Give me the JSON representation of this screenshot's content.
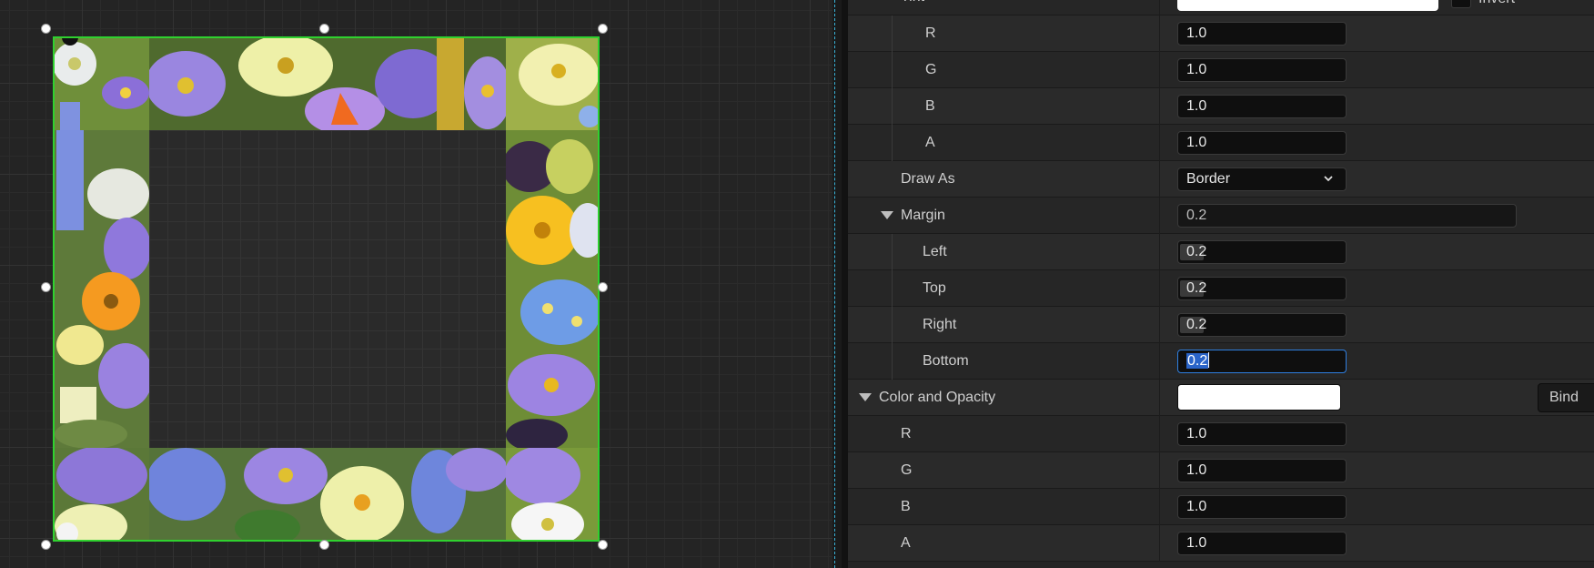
{
  "details": {
    "tint_row": {
      "label": "Tint",
      "extra_label": "Invert"
    },
    "brush_color": [
      {
        "label": "R",
        "value": "1.0"
      },
      {
        "label": "G",
        "value": "1.0"
      },
      {
        "label": "B",
        "value": "1.0"
      },
      {
        "label": "A",
        "value": "1.0"
      }
    ],
    "draw_as": {
      "label": "Draw As",
      "value": "Border"
    },
    "margin": {
      "label": "Margin",
      "value": "0.2",
      "children": [
        {
          "label": "Left",
          "value": "0.2"
        },
        {
          "label": "Top",
          "value": "0.2"
        },
        {
          "label": "Right",
          "value": "0.2"
        },
        {
          "label": "Bottom",
          "value": "0.2"
        }
      ]
    },
    "color_and_opacity": {
      "label": "Color and Opacity",
      "bind_label": "Bind",
      "swatch_color": "#ffffff",
      "children": [
        {
          "label": "R",
          "value": "1.0"
        },
        {
          "label": "G",
          "value": "1.0"
        },
        {
          "label": "B",
          "value": "1.0"
        },
        {
          "label": "A",
          "value": "1.0"
        }
      ]
    }
  },
  "colors": {
    "selection_outline": "#2fd12f",
    "focus_border": "#2f7fe0",
    "text_selection": "#2a64c8",
    "guide_line": "#3ab3d8"
  }
}
